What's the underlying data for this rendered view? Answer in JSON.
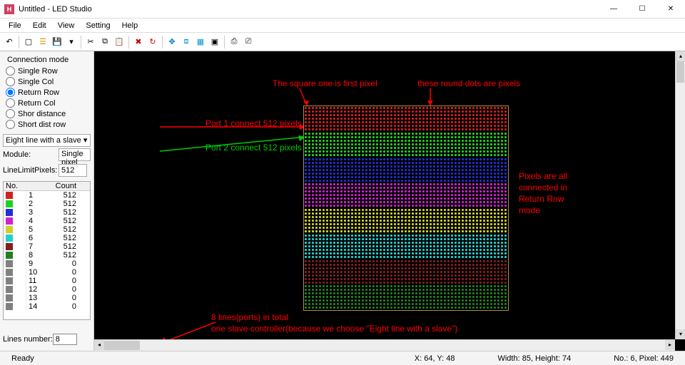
{
  "window": {
    "title": "Untitled - LED Studio"
  },
  "menu": {
    "file": "File",
    "edit": "Edit",
    "view": "View",
    "setting": "Setting",
    "help": "Help"
  },
  "connection": {
    "group": "Connection mode",
    "opts": {
      "single_row": "Single Row",
      "single_col": "Single Col",
      "return_row": "Return Row",
      "return_col": "Return Col",
      "shor_dist": "Shor distance",
      "short_dist_row": "Short dist row"
    },
    "selected": "return_row"
  },
  "slave_mode": "Eight line with a slave",
  "module_label": "Module:",
  "module_value": "Single pixel",
  "linelimit_label": "LineLimitPixels:",
  "linelimit_value": "512",
  "table": {
    "headers": {
      "no": "No.",
      "count": "Count"
    },
    "rows": [
      {
        "n": "1",
        "color": "#d02020",
        "count": "512"
      },
      {
        "n": "2",
        "color": "#20d020",
        "count": "512"
      },
      {
        "n": "3",
        "color": "#2030d0",
        "count": "512"
      },
      {
        "n": "4",
        "color": "#d020d0",
        "count": "512"
      },
      {
        "n": "5",
        "color": "#d0d020",
        "count": "512"
      },
      {
        "n": "6",
        "color": "#20d0d0",
        "count": "512"
      },
      {
        "n": "7",
        "color": "#802020",
        "count": "512"
      },
      {
        "n": "8",
        "color": "#208020",
        "count": "512"
      },
      {
        "n": "9",
        "color": "#808080",
        "count": "0"
      },
      {
        "n": "10",
        "color": "#808080",
        "count": "0"
      },
      {
        "n": "11",
        "color": "#808080",
        "count": "0"
      },
      {
        "n": "12",
        "color": "#808080",
        "count": "0"
      },
      {
        "n": "13",
        "color": "#808080",
        "count": "0"
      },
      {
        "n": "14",
        "color": "#808080",
        "count": "0"
      }
    ]
  },
  "lines_label": "Lines number:",
  "lines_value": "8",
  "annotations": {
    "square_first": "The square one is first pixel",
    "round_pixels": "these round dots are pixels",
    "port1": "Port 1 connect 512 pixels",
    "port2": "Port 2 connect 512 pixels",
    "right1": "Pixels are all",
    "right2": "connected in",
    "right3": "Return Row",
    "right4": "mode",
    "bottom1": "8 lines(ports) in total",
    "bottom2": "one slave controller(because we choose \"Eight line with a slave\")"
  },
  "status": {
    "ready": "Ready",
    "xy": "X: 64, Y: 48",
    "wh": "Width: 85, Height: 74",
    "np": "No.: 6, Pixel: 449"
  },
  "stripes": [
    "#d02020",
    "#20d020",
    "#2030d0",
    "#d020d0",
    "#d0d020",
    "#20d0d0",
    "#802020",
    "#208020"
  ]
}
